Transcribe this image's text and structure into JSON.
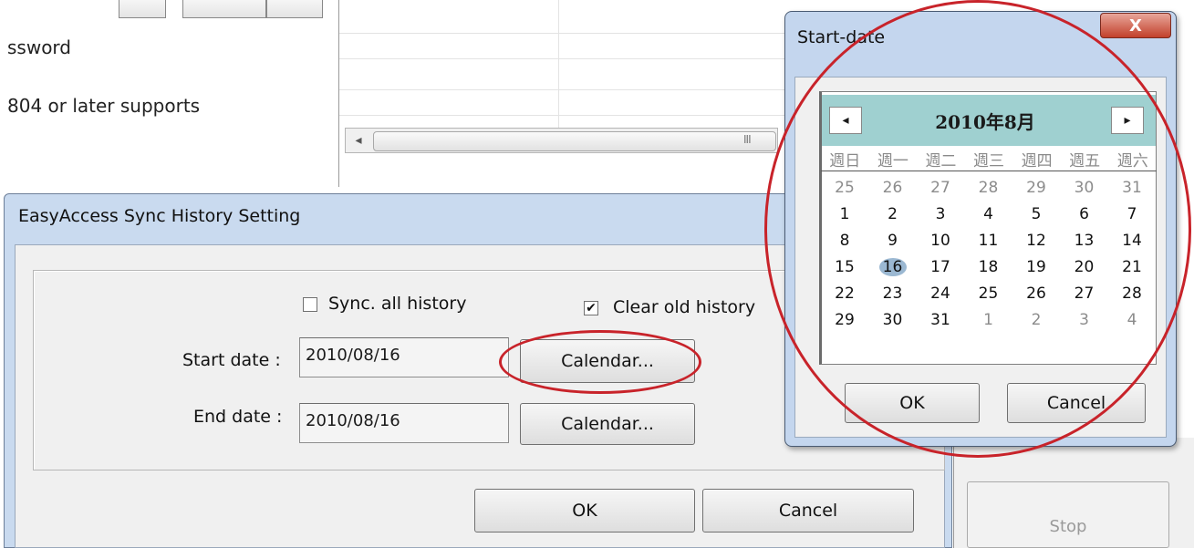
{
  "background": {
    "password_text": "ssword",
    "supports_text": "804 or later supports",
    "stop_label": "Stop",
    "scroll_grip": "III"
  },
  "sync_dialog": {
    "title": "EasyAccess Sync History Setting",
    "sync_all": {
      "label": "Sync. all history",
      "checked": false
    },
    "clear_old": {
      "label": "Clear old history",
      "checked": true
    },
    "start_date_label": "Start date :",
    "start_date_value": "2010/08/16",
    "end_date_label": "End date :",
    "end_date_value": "2010/08/16",
    "calendar_label": "Calendar...",
    "ok_label": "OK",
    "cancel_label": "Cancel"
  },
  "calendar_dialog": {
    "title": "Start-date",
    "close_label": "X",
    "month_label": "2010年8月",
    "prev_icon": "◂",
    "next_icon": "▸",
    "weekdays": [
      "週日",
      "週一",
      "週二",
      "週三",
      "週四",
      "週五",
      "週六"
    ],
    "weeks": [
      [
        "25",
        "26",
        "27",
        "28",
        "29",
        "30",
        "31"
      ],
      [
        "1",
        "2",
        "3",
        "4",
        "5",
        "6",
        "7"
      ],
      [
        "8",
        "9",
        "10",
        "11",
        "12",
        "13",
        "14"
      ],
      [
        "15",
        "16",
        "17",
        "18",
        "19",
        "20",
        "21"
      ],
      [
        "22",
        "23",
        "24",
        "25",
        "26",
        "27",
        "28"
      ],
      [
        "29",
        "30",
        "31",
        "1",
        "2",
        "3",
        "4"
      ]
    ],
    "selected_day": "16",
    "ok_label": "OK",
    "cancel_label": "Cancel"
  },
  "colors": {
    "annotation": "#c8232a",
    "calendar_header": "#9fd0d0",
    "selected_day": "#9bb8d2"
  }
}
